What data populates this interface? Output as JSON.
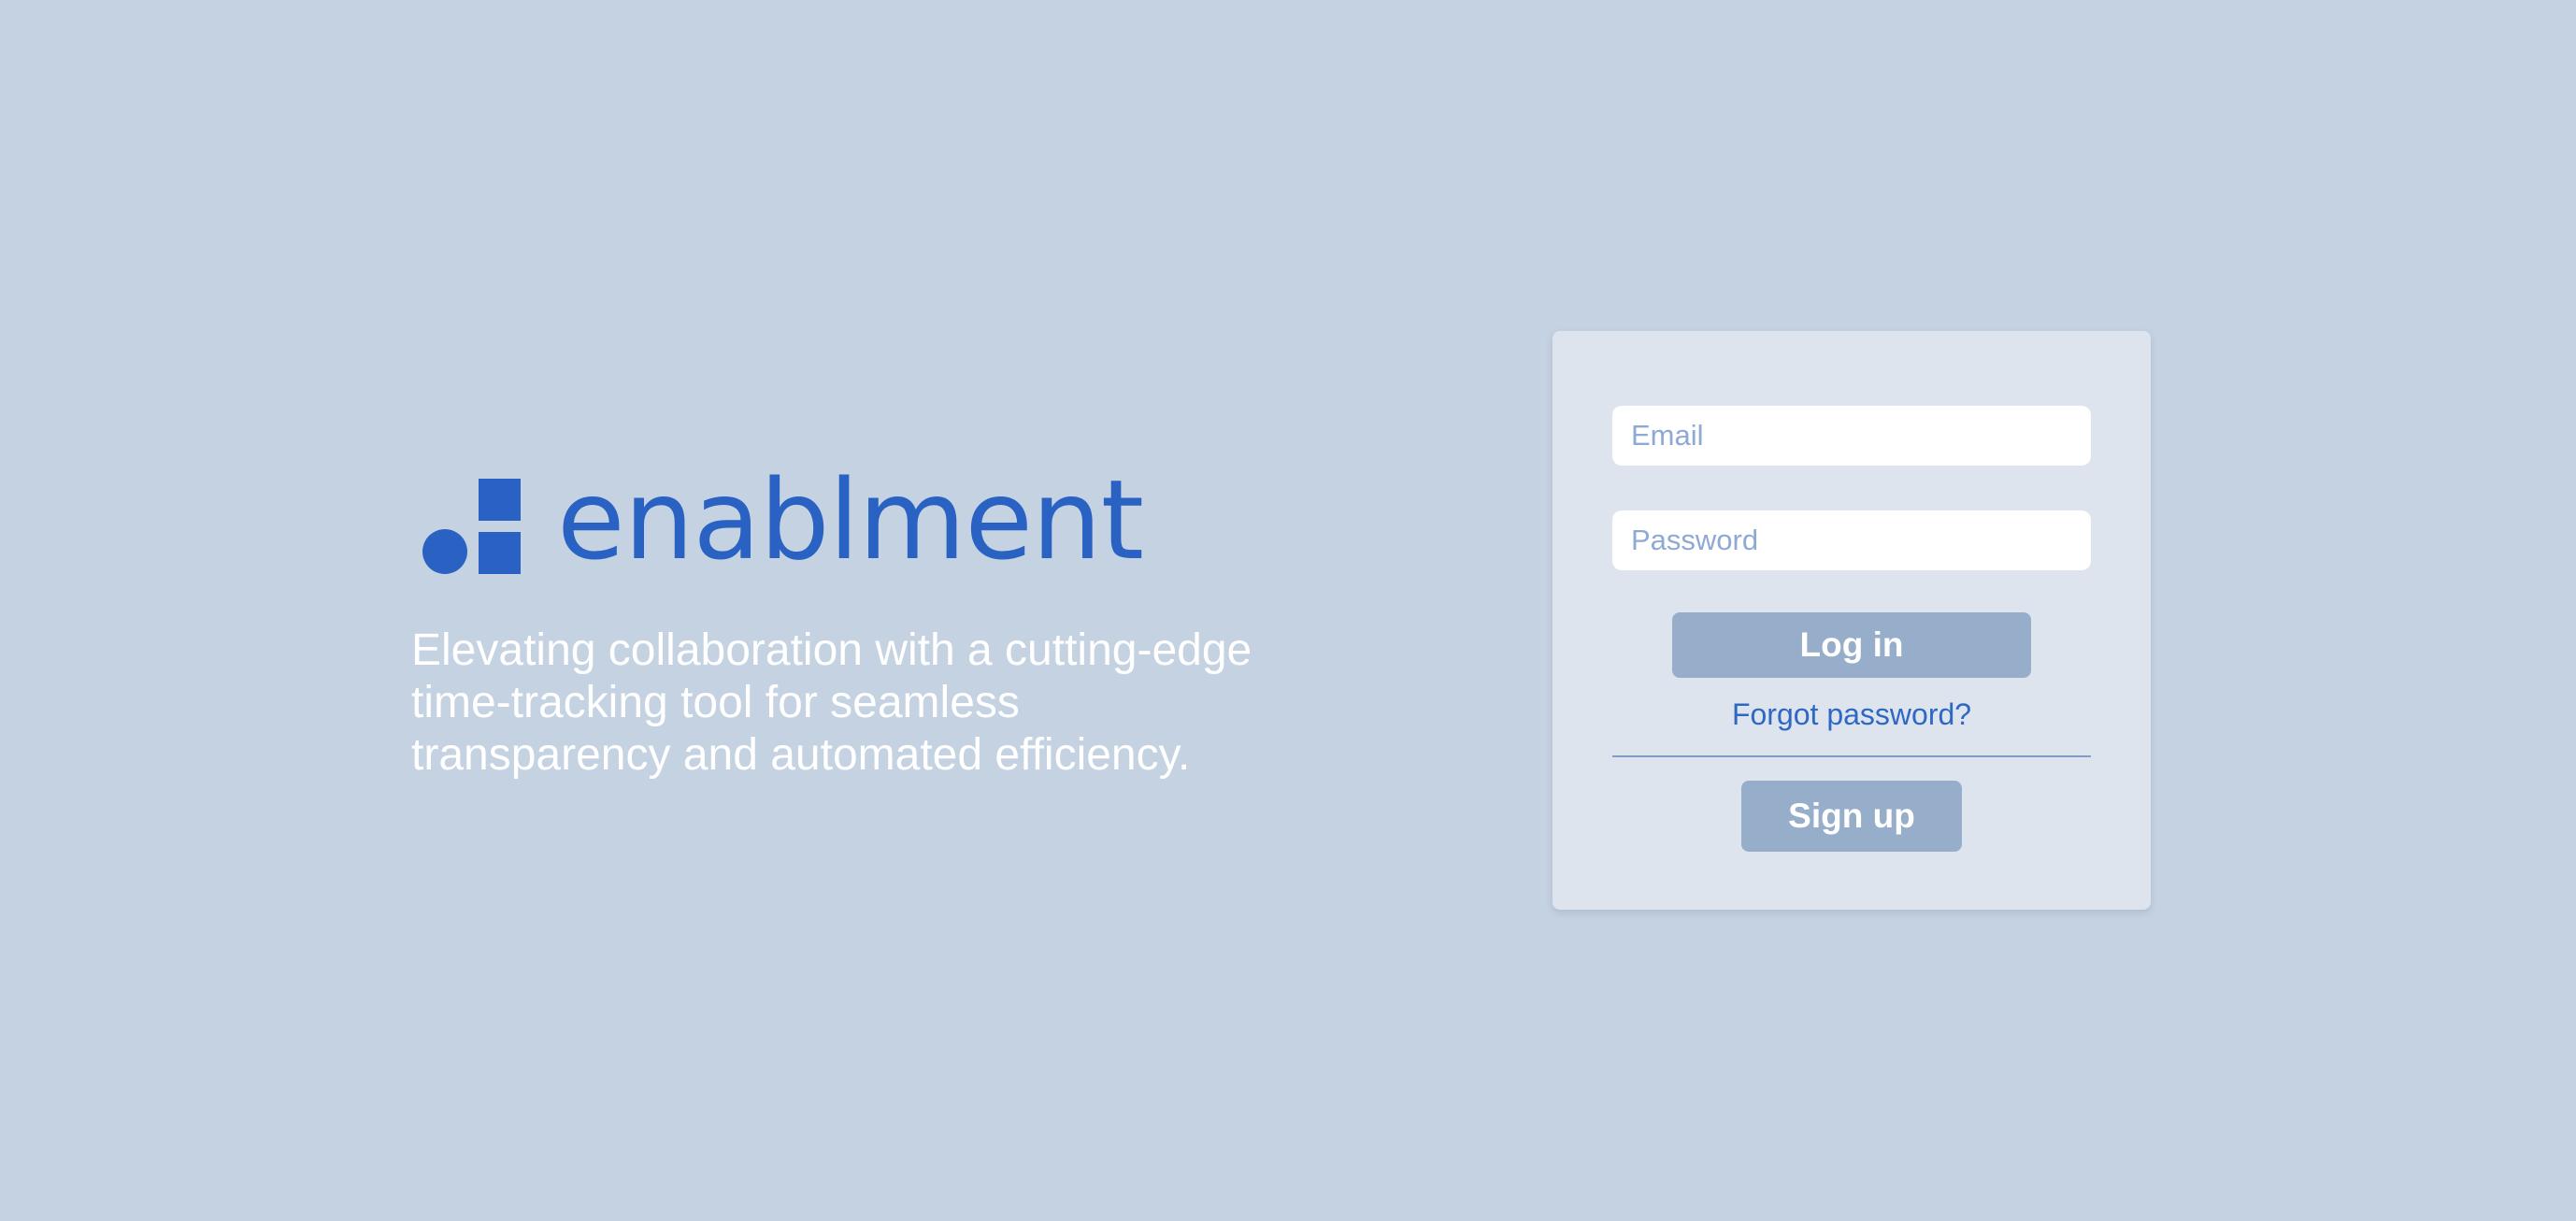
{
  "brand": {
    "name": "enablment",
    "logo_icon": "dot-and-squares-logo-icon",
    "brand_color": "#2962c3",
    "tagline_lines": [
      "Elevating collaboration with a cutting-edge",
      "time-tracking tool for seamless",
      "transparency and automated efficiency."
    ]
  },
  "login_form": {
    "email": {
      "placeholder": "Email",
      "value": ""
    },
    "password": {
      "placeholder": "Password",
      "value": ""
    },
    "login_label": "Log in",
    "forgot_label": "Forgot password?",
    "signup_label": "Sign up",
    "button_color": "#97aecb"
  },
  "colors": {
    "background": "#c5d2e2",
    "card": "#dde4ed",
    "link": "#2f68c4"
  }
}
